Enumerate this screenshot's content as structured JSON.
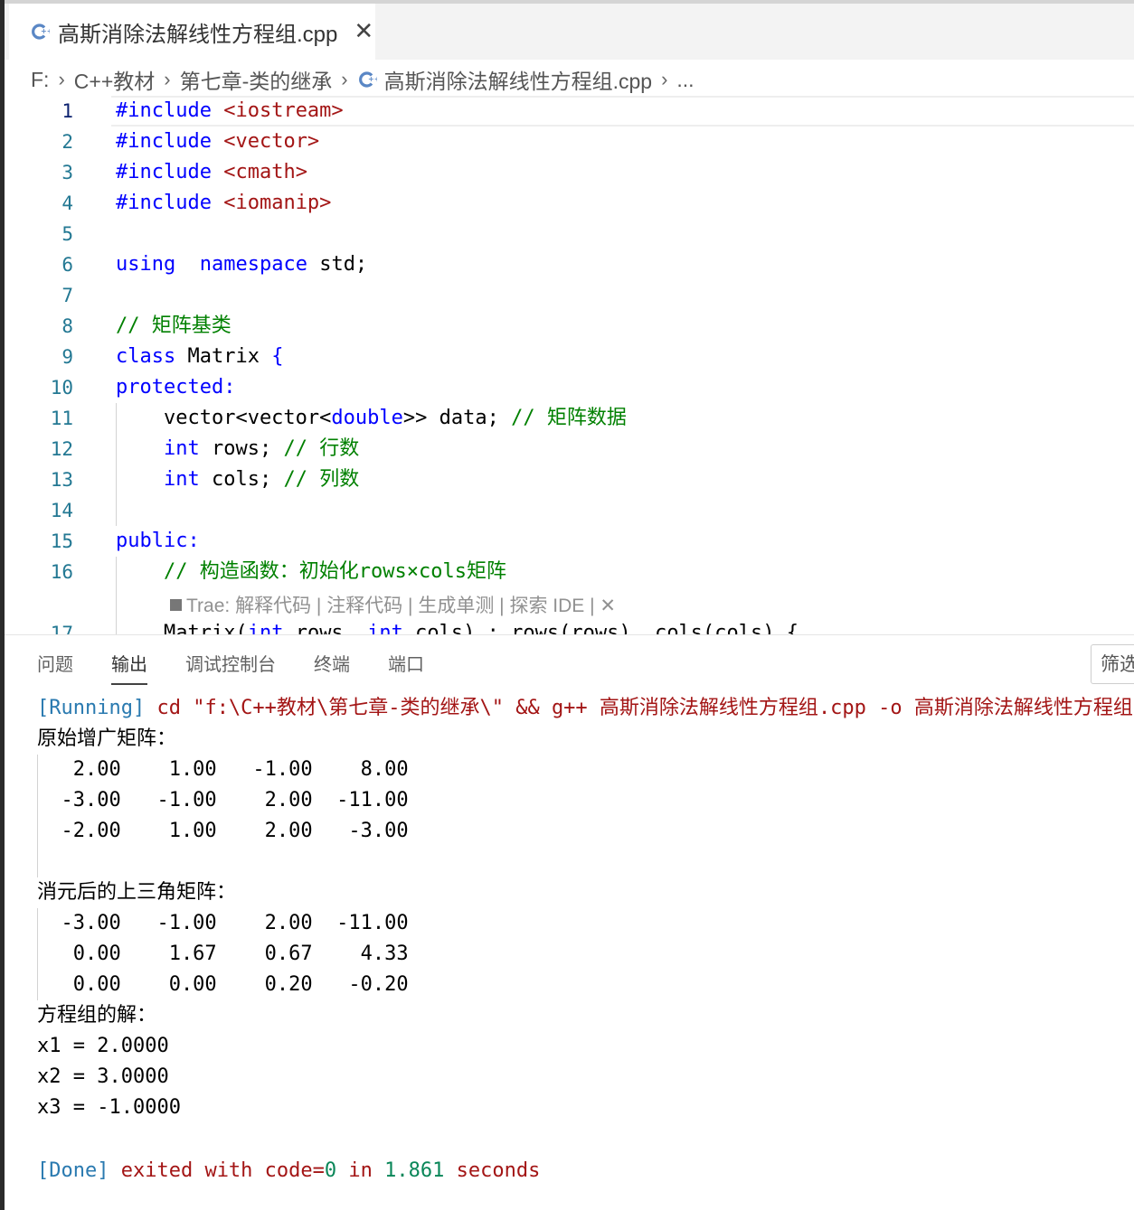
{
  "tab": {
    "title": "高斯消除法解线性方程组.cpp",
    "close": "✕"
  },
  "breadcrumb": {
    "drive": "F:",
    "folder1": "C++教材",
    "folder2": "第七章-类的继承",
    "file": "高斯消除法解线性方程组.cpp",
    "more": "..."
  },
  "editor": {
    "lines": [
      {
        "n": "1",
        "tokens": [
          [
            "kw",
            "#include "
          ],
          [
            "str",
            "<iostream>"
          ]
        ]
      },
      {
        "n": "2",
        "tokens": [
          [
            "kw",
            "#include "
          ],
          [
            "str",
            "<vector>"
          ]
        ]
      },
      {
        "n": "3",
        "tokens": [
          [
            "kw",
            "#include "
          ],
          [
            "str",
            "<cmath>"
          ]
        ]
      },
      {
        "n": "4",
        "tokens": [
          [
            "kw",
            "#include "
          ],
          [
            "str",
            "<iomanip>"
          ]
        ]
      },
      {
        "n": "5",
        "tokens": []
      },
      {
        "n": "6",
        "tokens": [
          [
            "kw",
            "using"
          ],
          [
            "",
            "  "
          ],
          [
            "kw",
            "namespace"
          ],
          [
            "",
            " std;"
          ]
        ]
      },
      {
        "n": "7",
        "tokens": []
      },
      {
        "n": "8",
        "tokens": [
          [
            "cmt",
            "// "
          ],
          [
            "cmtcn",
            "矩阵基类"
          ]
        ]
      },
      {
        "n": "9",
        "tokens": [
          [
            "kw",
            "class"
          ],
          [
            "",
            " Matrix "
          ],
          [
            "kw",
            "{"
          ]
        ]
      },
      {
        "n": "10",
        "tokens": [
          [
            "kw",
            "protected:"
          ]
        ]
      },
      {
        "n": "11",
        "tokens": [
          [
            "",
            "    vector<vector<"
          ],
          [
            "kw",
            "double"
          ],
          [
            "",
            ">> data; "
          ],
          [
            "cmt",
            "// "
          ],
          [
            "cmtcn",
            "矩阵数据"
          ]
        ]
      },
      {
        "n": "12",
        "tokens": [
          [
            "",
            "    "
          ],
          [
            "kw",
            "int"
          ],
          [
            "",
            " rows; "
          ],
          [
            "cmt",
            "// "
          ],
          [
            "cmtcn",
            "行数"
          ]
        ]
      },
      {
        "n": "13",
        "tokens": [
          [
            "",
            "    "
          ],
          [
            "kw",
            "int"
          ],
          [
            "",
            " cols; "
          ],
          [
            "cmt",
            "// "
          ],
          [
            "cmtcn",
            "列数"
          ]
        ]
      },
      {
        "n": "14",
        "tokens": []
      },
      {
        "n": "15",
        "tokens": [
          [
            "kw",
            "public:"
          ]
        ]
      },
      {
        "n": "16",
        "tokens": [
          [
            "",
            "    "
          ],
          [
            "cmt",
            "// "
          ],
          [
            "cmtcn",
            "构造函数："
          ],
          [
            "cmtcn",
            "初始化"
          ],
          [
            "cmt",
            "rows×cols"
          ],
          [
            "cmtcn",
            "矩阵"
          ]
        ]
      },
      {
        "n": "17",
        "tokens": [
          [
            "",
            "    Matrix("
          ],
          [
            "kw",
            "int"
          ],
          [
            "",
            " rows, "
          ],
          [
            "kw",
            "int"
          ],
          [
            "",
            " cols) : rows(rows), cols(cols) {"
          ]
        ]
      }
    ],
    "codelens": "Trae: 解释代码 | 注释代码 | 生成单测 | 探索 IDE | ✕"
  },
  "panel": {
    "tabs": [
      "问题",
      "输出",
      "调试控制台",
      "终端",
      "端口"
    ],
    "active_tab": "输出",
    "filter": "筛选"
  },
  "output": {
    "run_tag": "[Running]",
    "run_cmd_a": " cd \"f:\\C++",
    "run_cmd_cn1": "教材",
    "run_cmd_b": "\\",
    "run_cmd_cn2": "第七章",
    "run_cmd_c": "-",
    "run_cmd_cn3": "类的继承",
    "run_cmd_d": "\\\" && g++ ",
    "run_cmd_cn4": "高斯消除法解线性方程组",
    "run_cmd_e": ".cpp -o ",
    "run_cmd_cn5": "高斯消除法解线性方程组",
    "heading1": "原始增广矩阵：",
    "matrix1": [
      "   2.00    1.00   -1.00    8.00",
      "  -3.00   -1.00    2.00  -11.00",
      "  -2.00    1.00    2.00   -3.00"
    ],
    "heading2": "消元后的上三角矩阵：",
    "matrix2": [
      "  -3.00   -1.00    2.00  -11.00",
      "   0.00    1.67    0.67    4.33",
      "   0.00    0.00    0.20   -0.20"
    ],
    "heading3": "方程组的解：",
    "solutions": [
      "x1 = 2.0000",
      "x2 = 3.0000",
      "x3 = -1.0000"
    ],
    "done_tag": "[Done]",
    "done_a": " exited with code=",
    "done_code": "0",
    "done_b": " in ",
    "done_time": "1.861",
    "done_c": " seconds"
  },
  "colors": {
    "keyword": "#0000ff",
    "string": "#a31515",
    "comment": "#008000",
    "line_number": "#237893",
    "running": "#2a7ab0"
  },
  "icons": {
    "tab_file": "cpp-file-icon",
    "crumb_file": "cpp-file-icon",
    "crumb_sep": "chevron-right-icon"
  }
}
